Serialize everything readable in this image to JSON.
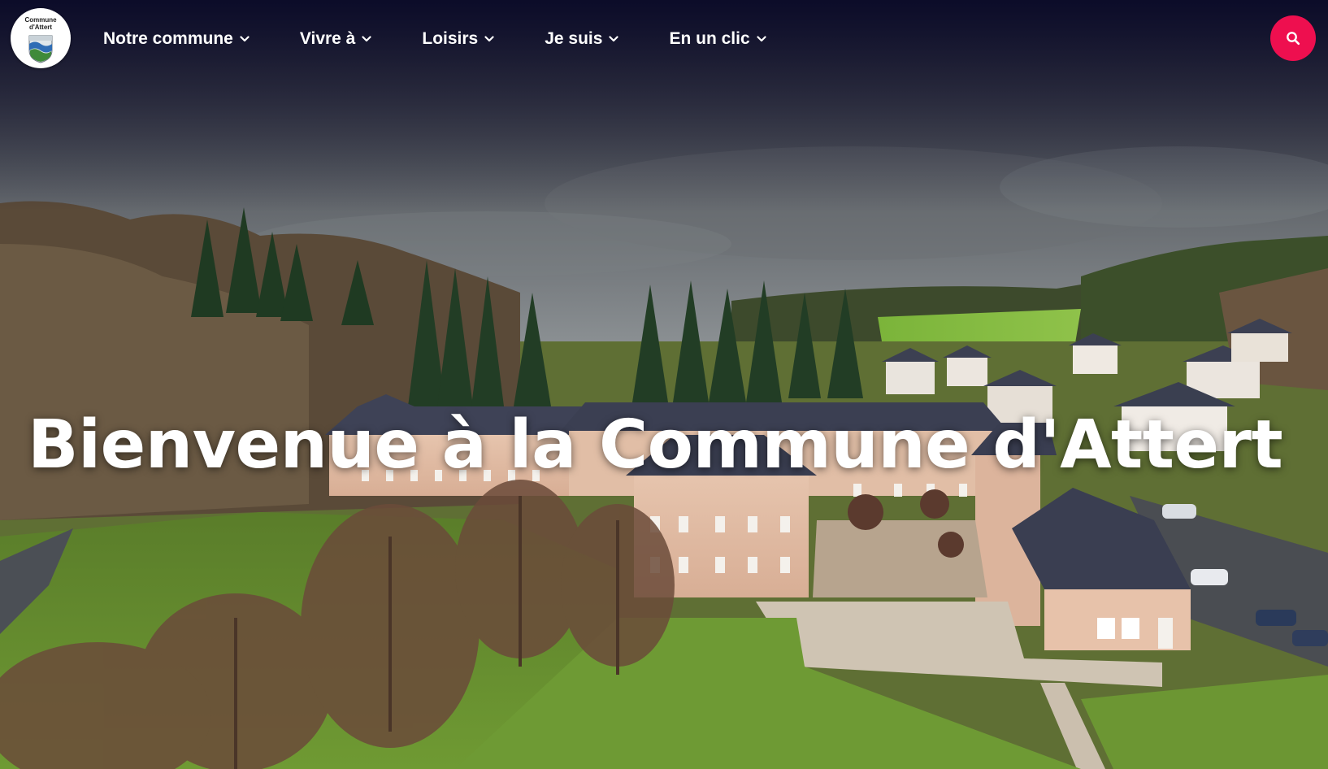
{
  "logo": {
    "line1": "Commune",
    "line2": "d'Attert"
  },
  "nav": {
    "items": [
      {
        "label": "Notre commune"
      },
      {
        "label": "Vivre à"
      },
      {
        "label": "Loisirs"
      },
      {
        "label": "Je suis"
      },
      {
        "label": "En un clic"
      }
    ],
    "chevron_icon": "chevron-down-icon",
    "search_icon": "search-icon"
  },
  "hero": {
    "title": "Bienvenue à la Commune d'Attert"
  },
  "colors": {
    "accent": "#ee0f4f",
    "nav_text": "#ffffff",
    "nav_background": "#0c0c28"
  }
}
